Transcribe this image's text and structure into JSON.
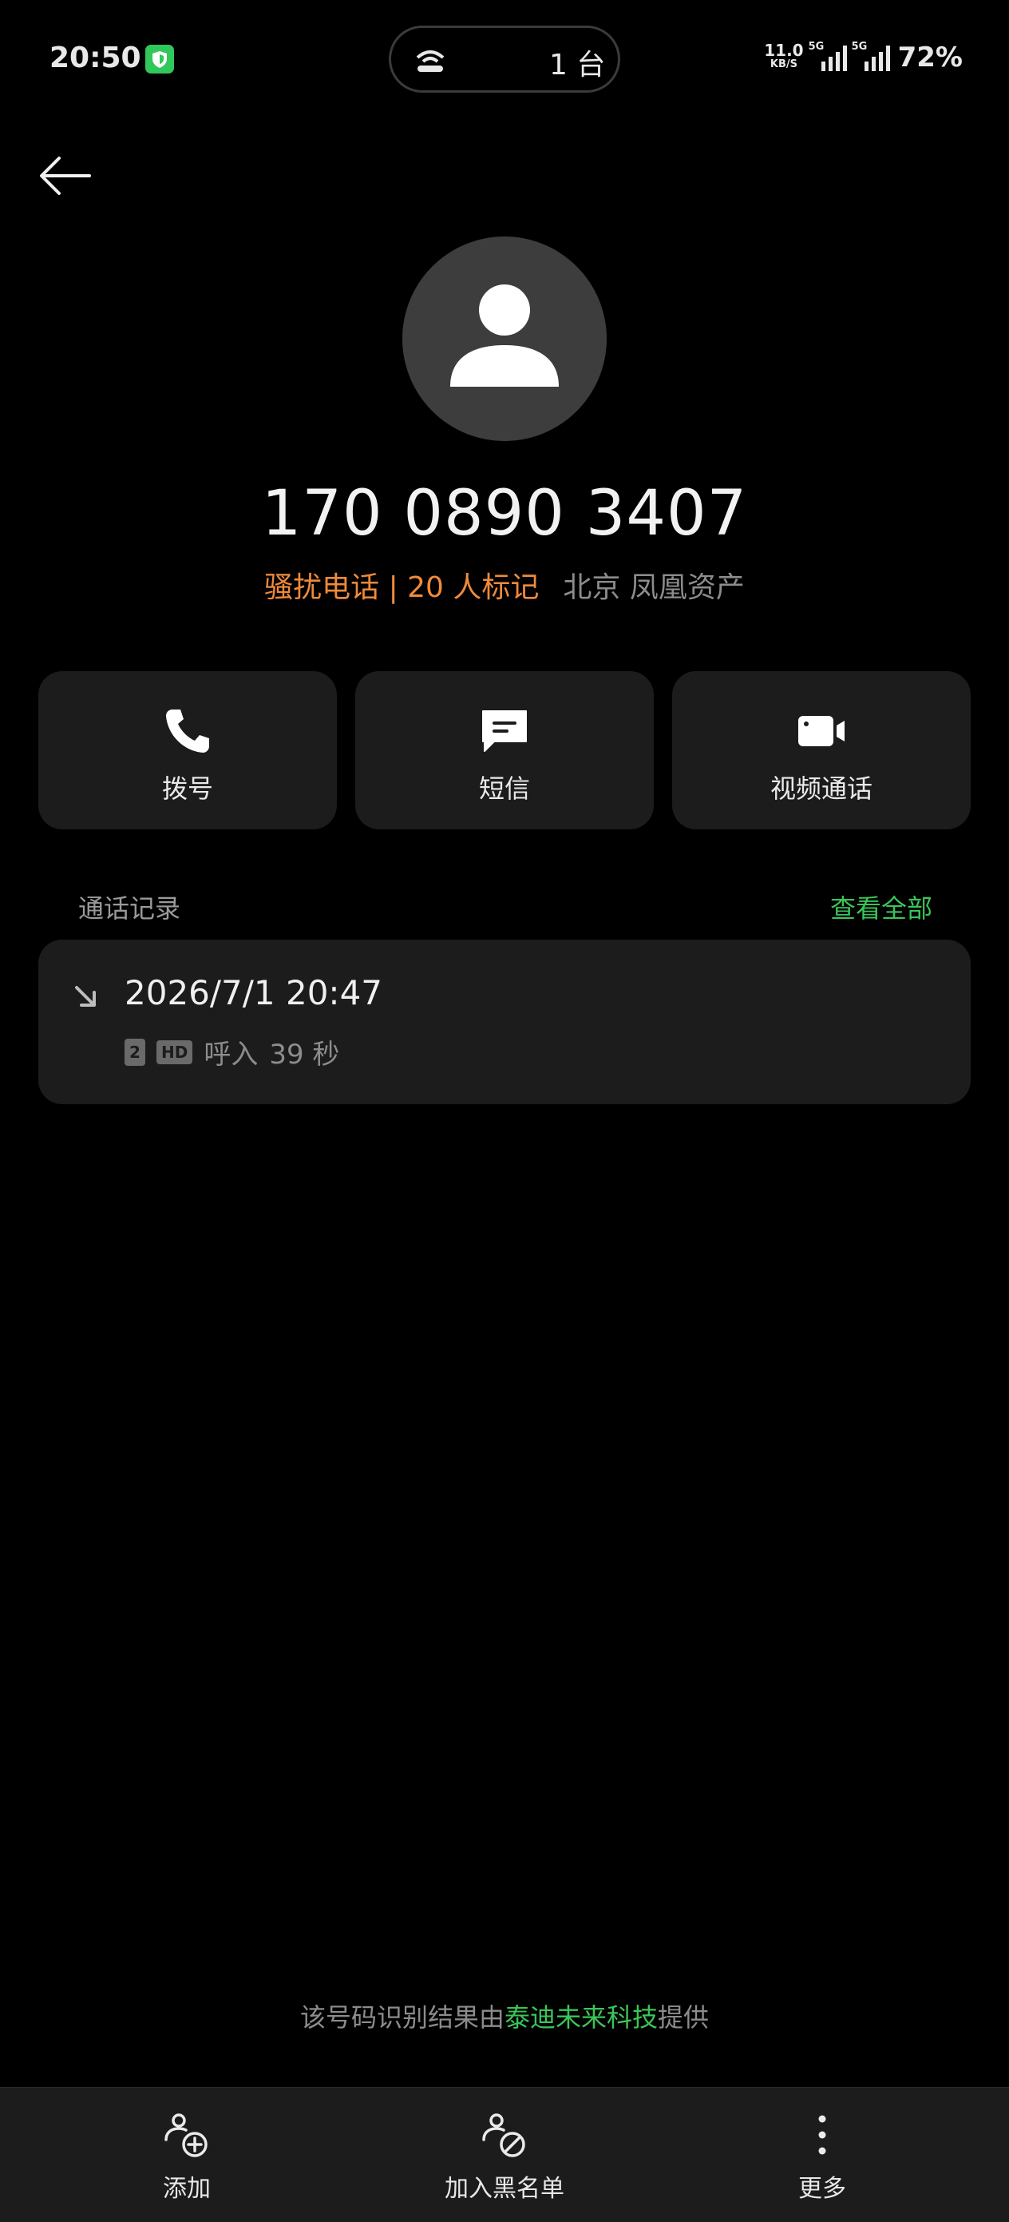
{
  "status_bar": {
    "time": "20:50",
    "devices": "1 台",
    "speed_value": "11.0",
    "speed_unit": "KB/S",
    "network_1": "5G",
    "network_2": "5G",
    "battery": "72%"
  },
  "contact": {
    "phone_number": "170 0890 3407",
    "spam_tag": "骚扰电话 | 20 人标记",
    "location": "北京 凤凰资产"
  },
  "actions": [
    {
      "label": "拨号",
      "icon": "phone-icon"
    },
    {
      "label": "短信",
      "icon": "message-icon"
    },
    {
      "label": "视频通话",
      "icon": "video-icon"
    }
  ],
  "call_log": {
    "title": "通话记录",
    "view_all": "查看全部",
    "entries": [
      {
        "datetime": "2026/7/1 20:47",
        "sim": "2",
        "hd": "HD",
        "type": "呼入",
        "duration": "39 秒"
      }
    ]
  },
  "provider": {
    "prefix": "该号码识别结果由",
    "name": "泰迪未来科技",
    "suffix": "提供"
  },
  "bottom_nav": [
    {
      "label": "添加",
      "icon": "add-contact-icon"
    },
    {
      "label": "加入黑名单",
      "icon": "block-contact-icon"
    },
    {
      "label": "更多",
      "icon": "more-icon"
    }
  ],
  "colors": {
    "background": "#000000",
    "card": "#1c1c1c",
    "spam": "#f08a3a",
    "accent_green": "#3ac558"
  }
}
